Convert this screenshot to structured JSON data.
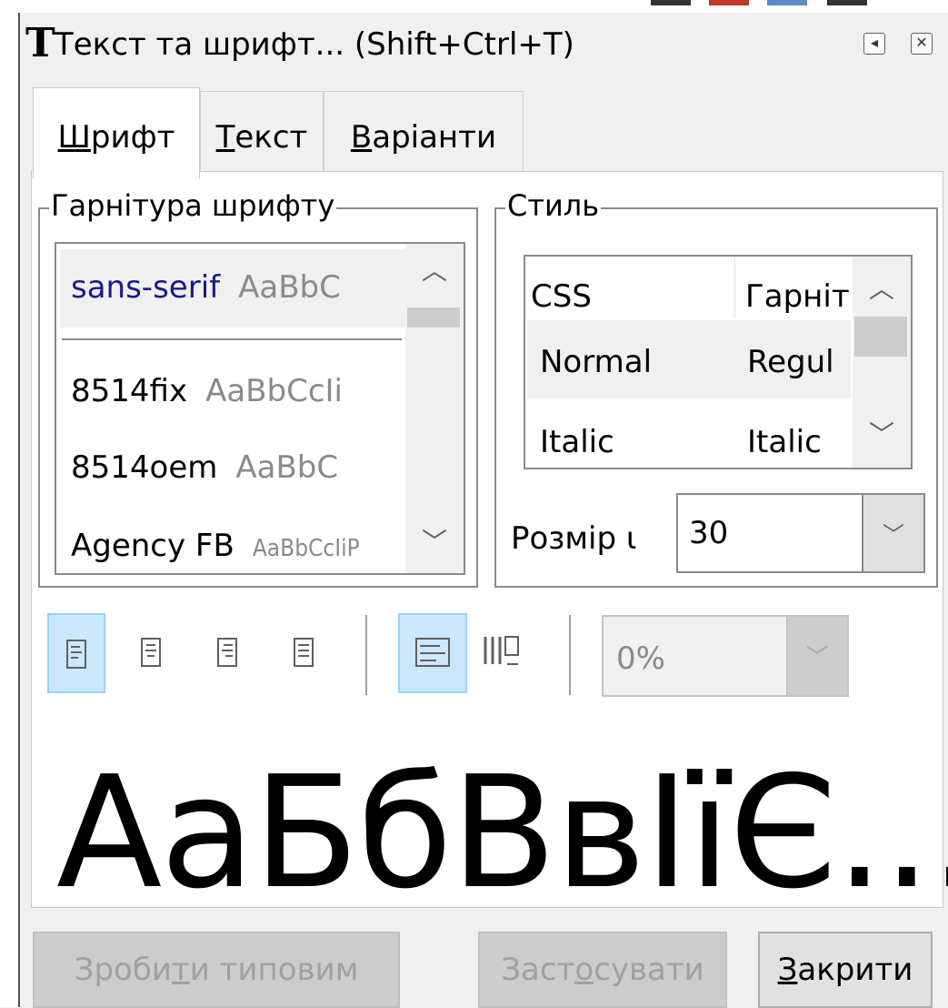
{
  "window": {
    "title": "Текст та шрифт... (Shift+Ctrl+T)",
    "logo_letter": "T",
    "buttons": [
      {
        "icon": "collapse-icon",
        "glyph": "◂"
      },
      {
        "icon": "close-icon",
        "glyph": "✕"
      }
    ]
  },
  "tabs": [
    {
      "label": "Шрифт",
      "accel_index": 0,
      "active": true
    },
    {
      "label": "Текст",
      "accel_index": 0,
      "active": false
    },
    {
      "label": "Варіанти",
      "accel_index": 0,
      "active": false
    }
  ],
  "font_family": {
    "legend": "Гарнітура шрифту",
    "selected": {
      "name": "sans-serif",
      "preview": "AaBbC"
    },
    "items": [
      {
        "name": "8514fix",
        "preview": "AaBbCcIi"
      },
      {
        "name": "8514oem",
        "preview": "AaBbC"
      },
      {
        "name": "Agency FB",
        "preview": "AaBbCcIiP"
      }
    ]
  },
  "style": {
    "legend": "Стиль",
    "columns": [
      "CSS",
      "Гарніт"
    ],
    "rows": [
      {
        "css": "Normal",
        "face": "Regul",
        "selected": true
      },
      {
        "css": "Italic",
        "face": "Italic",
        "selected": false
      }
    ],
    "size_label": "Розмір ι",
    "size_value": "30"
  },
  "toolbar": {
    "align_icons": [
      "align-left-icon",
      "align-center-icon",
      "align-right-icon",
      "align-justify-icon"
    ],
    "orientation_icons": [
      "horizontal-text-icon",
      "vertical-text-icon"
    ],
    "spacing_value": "0%"
  },
  "preview": {
    "text": "АаБбВвІїЄ..."
  },
  "buttons": {
    "set_default": "Зробити типовим",
    "apply": "Застосувати",
    "close": "Закрити"
  },
  "colors": {
    "selection_text": "#1a1a8c",
    "toggle_on": "#cce8ff"
  }
}
